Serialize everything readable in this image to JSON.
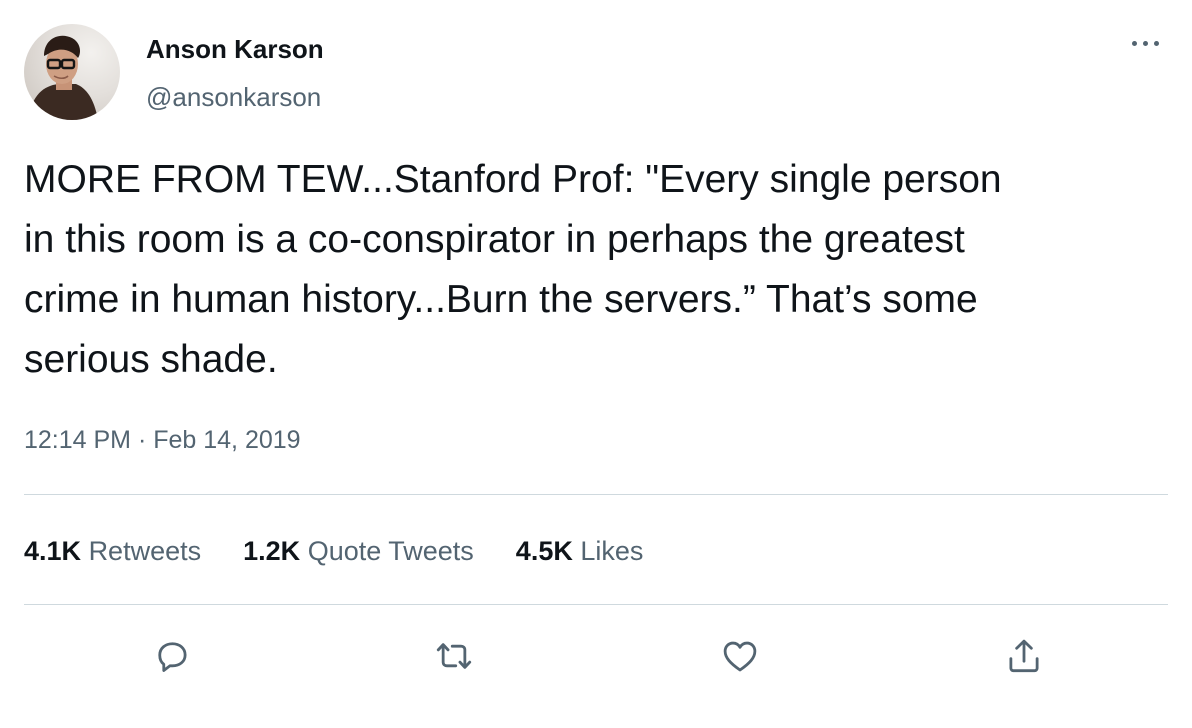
{
  "author": {
    "name": "Anson Karson",
    "handle": "@ansonkarson"
  },
  "tweet": {
    "text": "MORE FROM TEW...Stanford Prof: \"Every single person\nin this room is a co-conspirator in perhaps the greatest\ncrime in human history...Burn the servers.” That’s some\nserious shade.",
    "timestamp": "12:14 PM · Feb 14, 2019"
  },
  "stats": {
    "retweets_count": "4.1K",
    "retweets_label": "Retweets",
    "quotes_count": "1.2K",
    "quotes_label": "Quote Tweets",
    "likes_count": "4.5K",
    "likes_label": "Likes"
  },
  "actions": {
    "reply_icon": "reply-icon",
    "retweet_icon": "retweet-icon",
    "like_icon": "heart-icon",
    "share_icon": "share-icon"
  },
  "colors": {
    "primary_text": "#0f1419",
    "secondary_text": "#536471",
    "divider": "#cfd9de"
  }
}
